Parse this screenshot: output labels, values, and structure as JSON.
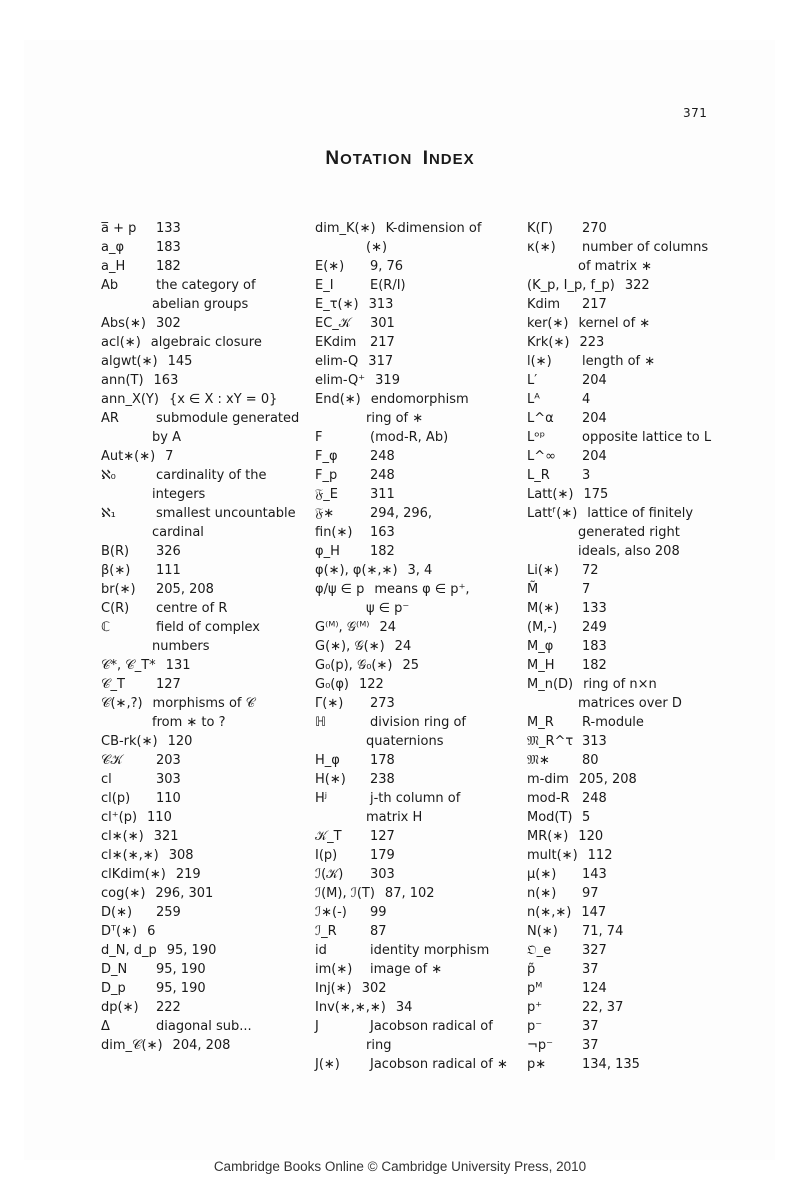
{
  "page": {
    "number": "371",
    "title_first_letter": "N",
    "title_rest": "OTATION",
    "title_second_letter": "I",
    "title_second_rest": "NDEX",
    "footer": "Cambridge Books Online © Cambridge University Press, 2010"
  },
  "columns": [
    [
      {
        "symbol": "a̅ + p",
        "desc": "133"
      },
      {
        "symbol": "a_φ",
        "desc": "183"
      },
      {
        "symbol": "a_H",
        "desc": "182"
      },
      {
        "symbol": "Ab",
        "desc": "the category of",
        "cont": "abelian groups"
      },
      {
        "symbol": "Abs(∗)",
        "desc": "302",
        "wide": true
      },
      {
        "symbol": "acl(∗)",
        "desc": "algebraic closure",
        "wide": true
      },
      {
        "symbol": "algwt(∗)",
        "desc": "145",
        "wide": true
      },
      {
        "symbol": "ann(T)",
        "desc": "163",
        "wide": true
      },
      {
        "symbol": "ann_X(Y)",
        "desc": "{x ∈ X : xY = 0}",
        "wide": true
      },
      {
        "symbol": "AR",
        "desc": "submodule generated",
        "cont": "by A"
      },
      {
        "symbol": "Aut∗(∗)",
        "desc": "7",
        "wide": true
      },
      {
        "symbol": "ℵ₀",
        "desc": "cardinality of the",
        "cont": "integers"
      },
      {
        "symbol": "ℵ₁",
        "desc": "smallest uncountable",
        "cont": "cardinal"
      },
      {
        "symbol": "B(R)",
        "desc": "326"
      },
      {
        "symbol": "β(∗)",
        "desc": "111"
      },
      {
        "symbol": "br(∗)",
        "desc": "205, 208"
      },
      {
        "symbol": "C(R)",
        "desc": "centre of R"
      },
      {
        "symbol": "ℂ",
        "desc": "field of complex",
        "cont": "numbers"
      },
      {
        "symbol": "𝒞*, 𝒞_T*",
        "desc": "131",
        "wide": true
      },
      {
        "symbol": "𝒞_T",
        "desc": "127"
      },
      {
        "symbol": "𝒞(∗,?)",
        "desc": "morphisms of 𝒞",
        "cont": "from ∗ to ?",
        "wide": true
      },
      {
        "symbol": "CB-rk(∗)",
        "desc": "120",
        "wide": true
      },
      {
        "symbol": "𝒞𝒦",
        "desc": "203"
      },
      {
        "symbol": "cl",
        "desc": "303"
      },
      {
        "symbol": "cl(p)",
        "desc": "110"
      },
      {
        "symbol": "cl⁺(p)",
        "desc": "110",
        "wide": true
      },
      {
        "symbol": "cl∗(∗)",
        "desc": "321",
        "wide": true
      },
      {
        "symbol": "cl∗(∗,∗)",
        "desc": "308",
        "wide": true
      },
      {
        "symbol": "clKdim(∗)",
        "desc": "219",
        "wide": true
      },
      {
        "symbol": "cog(∗)",
        "desc": "296, 301",
        "wide": true
      },
      {
        "symbol": "D(∗)",
        "desc": "259"
      },
      {
        "symbol": "Dᵀ(∗)",
        "desc": "6",
        "wide": true
      },
      {
        "symbol": "d_N, d_p",
        "desc": "95, 190",
        "wide": true
      },
      {
        "symbol": "D_N",
        "desc": "95, 190"
      },
      {
        "symbol": "D_p",
        "desc": "95, 190"
      },
      {
        "symbol": "dp(∗)",
        "desc": "222"
      },
      {
        "symbol": "Δ",
        "desc": "diagonal sub..."
      },
      {
        "symbol": "dim_𝒞(∗)",
        "desc": "204, 208",
        "wide": true
      }
    ],
    [
      {
        "symbol": "dim_K(∗)",
        "desc": "K-dimension of",
        "cont": "(∗)",
        "wide": true
      },
      {
        "symbol": "E(∗)",
        "desc": "9, 76"
      },
      {
        "symbol": "E_I",
        "desc": "E(R/I)"
      },
      {
        "symbol": "E_τ(∗)",
        "desc": "313",
        "wide": true
      },
      {
        "symbol": "EC_𝒦",
        "desc": "301"
      },
      {
        "symbol": "EKdim",
        "desc": "217"
      },
      {
        "symbol": "elim-Q",
        "desc": "317",
        "wide": true
      },
      {
        "symbol": "elim-Q⁺",
        "desc": "319",
        "wide": true
      },
      {
        "symbol": "End(∗)",
        "desc": "endomorphism",
        "cont": "ring of ∗",
        "wide": true
      },
      {
        "symbol": "F",
        "desc": "(mod-R, Ab)"
      },
      {
        "symbol": "F_φ",
        "desc": "248"
      },
      {
        "symbol": "F_p",
        "desc": "248"
      },
      {
        "symbol": "𝔉_E",
        "desc": "311"
      },
      {
        "symbol": "𝔉∗",
        "desc": "294, 296,"
      },
      {
        "symbol": "fin(∗)",
        "desc": "163"
      },
      {
        "symbol": "φ_H",
        "desc": "182"
      },
      {
        "symbol": "φ(∗), φ(∗,∗)",
        "desc": "3, 4",
        "wide": true
      },
      {
        "symbol": "φ/ψ ∈ p",
        "desc": "means φ ∈ p⁺,",
        "cont": "ψ ∈ p⁻",
        "wide": true
      },
      {
        "symbol": "G⁽ᴹ⁾, 𝒢⁽ᴹ⁾",
        "desc": "24",
        "wide": true
      },
      {
        "symbol": "G(∗), 𝒢(∗)",
        "desc": "24",
        "wide": true
      },
      {
        "symbol": "G₀(p), 𝒢₀(∗)",
        "desc": "25",
        "wide": true
      },
      {
        "symbol": "G₀(φ)",
        "desc": "122",
        "wide": true
      },
      {
        "symbol": "Γ(∗)",
        "desc": "273"
      },
      {
        "symbol": "ℍ",
        "desc": "division ring of",
        "cont": "quaternions"
      },
      {
        "symbol": "H_φ",
        "desc": "178"
      },
      {
        "symbol": "H(∗)",
        "desc": "238"
      },
      {
        "symbol": "Hʲ",
        "desc": "j-th column of",
        "cont": "matrix H"
      },
      {
        "symbol": "𝒦_T",
        "desc": "127"
      },
      {
        "symbol": "I(p)",
        "desc": "179"
      },
      {
        "symbol": "ℐ(𝒦)",
        "desc": "303"
      },
      {
        "symbol": "ℐ(M),  ℐ(T)",
        "desc": "87, 102",
        "wide": true
      },
      {
        "symbol": "ℐ∗(-)",
        "desc": "99"
      },
      {
        "symbol": "ℐ_R",
        "desc": "87"
      },
      {
        "symbol": "id",
        "desc": "identity morphism"
      },
      {
        "symbol": "im(∗)",
        "desc": "image of ∗"
      },
      {
        "symbol": "Inj(∗)",
        "desc": "302",
        "wide": true
      },
      {
        "symbol": "Inv(∗,∗,∗)",
        "desc": "34",
        "wide": true
      },
      {
        "symbol": "J",
        "desc": "Jacobson radical of",
        "cont": "ring"
      },
      {
        "symbol": "J(∗)",
        "desc": "Jacobson radical of ∗"
      }
    ],
    [
      {
        "symbol": "K(Γ)",
        "desc": "270"
      },
      {
        "symbol": "κ(∗)",
        "desc": "number of columns",
        "cont": "of matrix ∗"
      },
      {
        "symbol": "(K_p, I_p, f_p)",
        "desc": "322",
        "wide": true
      },
      {
        "symbol": "Kdim",
        "desc": "217"
      },
      {
        "symbol": "ker(∗)",
        "desc": "kernel of ∗",
        "wide": true
      },
      {
        "symbol": "Krk(∗)",
        "desc": "223",
        "wide": true
      },
      {
        "symbol": "l(∗)",
        "desc": "length of ∗"
      },
      {
        "symbol": "L′",
        "desc": "204"
      },
      {
        "symbol": "Lᴬ",
        "desc": "4"
      },
      {
        "symbol": "L^α",
        "desc": "204"
      },
      {
        "symbol": "Lᵒᵖ",
        "desc": "opposite lattice to L"
      },
      {
        "symbol": "L^∞",
        "desc": "204"
      },
      {
        "symbol": "L_R",
        "desc": "3"
      },
      {
        "symbol": "Latt(∗)",
        "desc": "175",
        "wide": true
      },
      {
        "symbol": "Lattᶠ(∗)",
        "desc": "lattice of finitely",
        "cont": "generated right",
        "cont2": "ideals, also 208",
        "wide": true
      },
      {
        "symbol": "Li(∗)",
        "desc": "72"
      },
      {
        "symbol": "M̃",
        "desc": "7"
      },
      {
        "symbol": "M(∗)",
        "desc": "133"
      },
      {
        "symbol": "(M,-)",
        "desc": "249"
      },
      {
        "symbol": "M_φ",
        "desc": "183"
      },
      {
        "symbol": "M_H",
        "desc": "182"
      },
      {
        "symbol": "M_n(D)",
        "desc": "ring of n×n",
        "cont": "matrices over D",
        "wide": true
      },
      {
        "symbol": "M_R",
        "desc": "R-module"
      },
      {
        "symbol": "𝔐_R^τ",
        "desc": "313"
      },
      {
        "symbol": "𝔐∗",
        "desc": "80"
      },
      {
        "symbol": "m-dim",
        "desc": "205, 208",
        "wide": true
      },
      {
        "symbol": "mod-R",
        "desc": "248"
      },
      {
        "symbol": "Mod(T)",
        "desc": "5"
      },
      {
        "symbol": "MR(∗)",
        "desc": "120",
        "wide": true
      },
      {
        "symbol": "mult(∗)",
        "desc": "112",
        "wide": true
      },
      {
        "symbol": "μ(∗)",
        "desc": "143"
      },
      {
        "symbol": "n(∗)",
        "desc": "97"
      },
      {
        "symbol": "n(∗,∗)",
        "desc": "147",
        "wide": true
      },
      {
        "symbol": "N(∗)",
        "desc": "71, 74"
      },
      {
        "symbol": "𝔒_e",
        "desc": "327"
      },
      {
        "symbol": "p̃",
        "desc": "37"
      },
      {
        "symbol": "pᴹ",
        "desc": "124"
      },
      {
        "symbol": "p⁺",
        "desc": "22, 37"
      },
      {
        "symbol": "p⁻",
        "desc": "37"
      },
      {
        "symbol": "¬p⁻",
        "desc": "37"
      },
      {
        "symbol": "p∗",
        "desc": "134, 135"
      }
    ]
  ]
}
